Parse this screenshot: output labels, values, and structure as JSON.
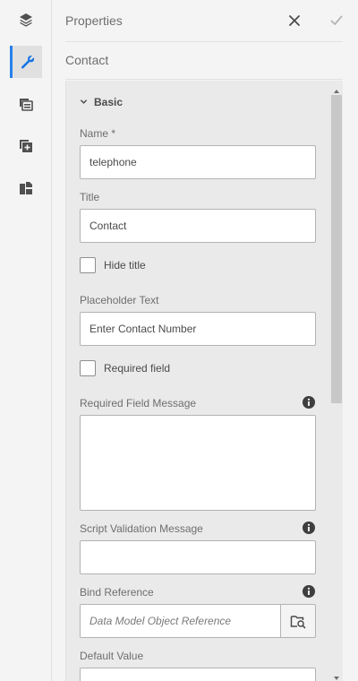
{
  "rail": {
    "items": [
      {
        "icon": "layers-icon"
      },
      {
        "icon": "wrench-icon",
        "active": true
      },
      {
        "icon": "style-panel-icon"
      },
      {
        "icon": "add-component-icon"
      },
      {
        "icon": "content-tree-icon"
      }
    ]
  },
  "header": {
    "title": "Properties"
  },
  "breadcrumb": {
    "label": "Contact"
  },
  "section": {
    "title": "Basic"
  },
  "fields": {
    "name_label": "Name *",
    "name_value": "telephone",
    "title_label": "Title",
    "title_value": "Contact",
    "hide_title_label": "Hide title",
    "placeholder_label": "Placeholder Text",
    "placeholder_value": "Enter Contact Number",
    "required_label": "Required field",
    "required_msg_label": "Required Field Message",
    "script_msg_label": "Script Validation Message",
    "bind_label": "Bind Reference",
    "bind_placeholder": "Data Model Object Reference",
    "default_label": "Default Value"
  },
  "colors": {
    "accent": "#1473e6",
    "panel_bg": "#f4f4f4",
    "form_bg": "#eaeaea"
  }
}
